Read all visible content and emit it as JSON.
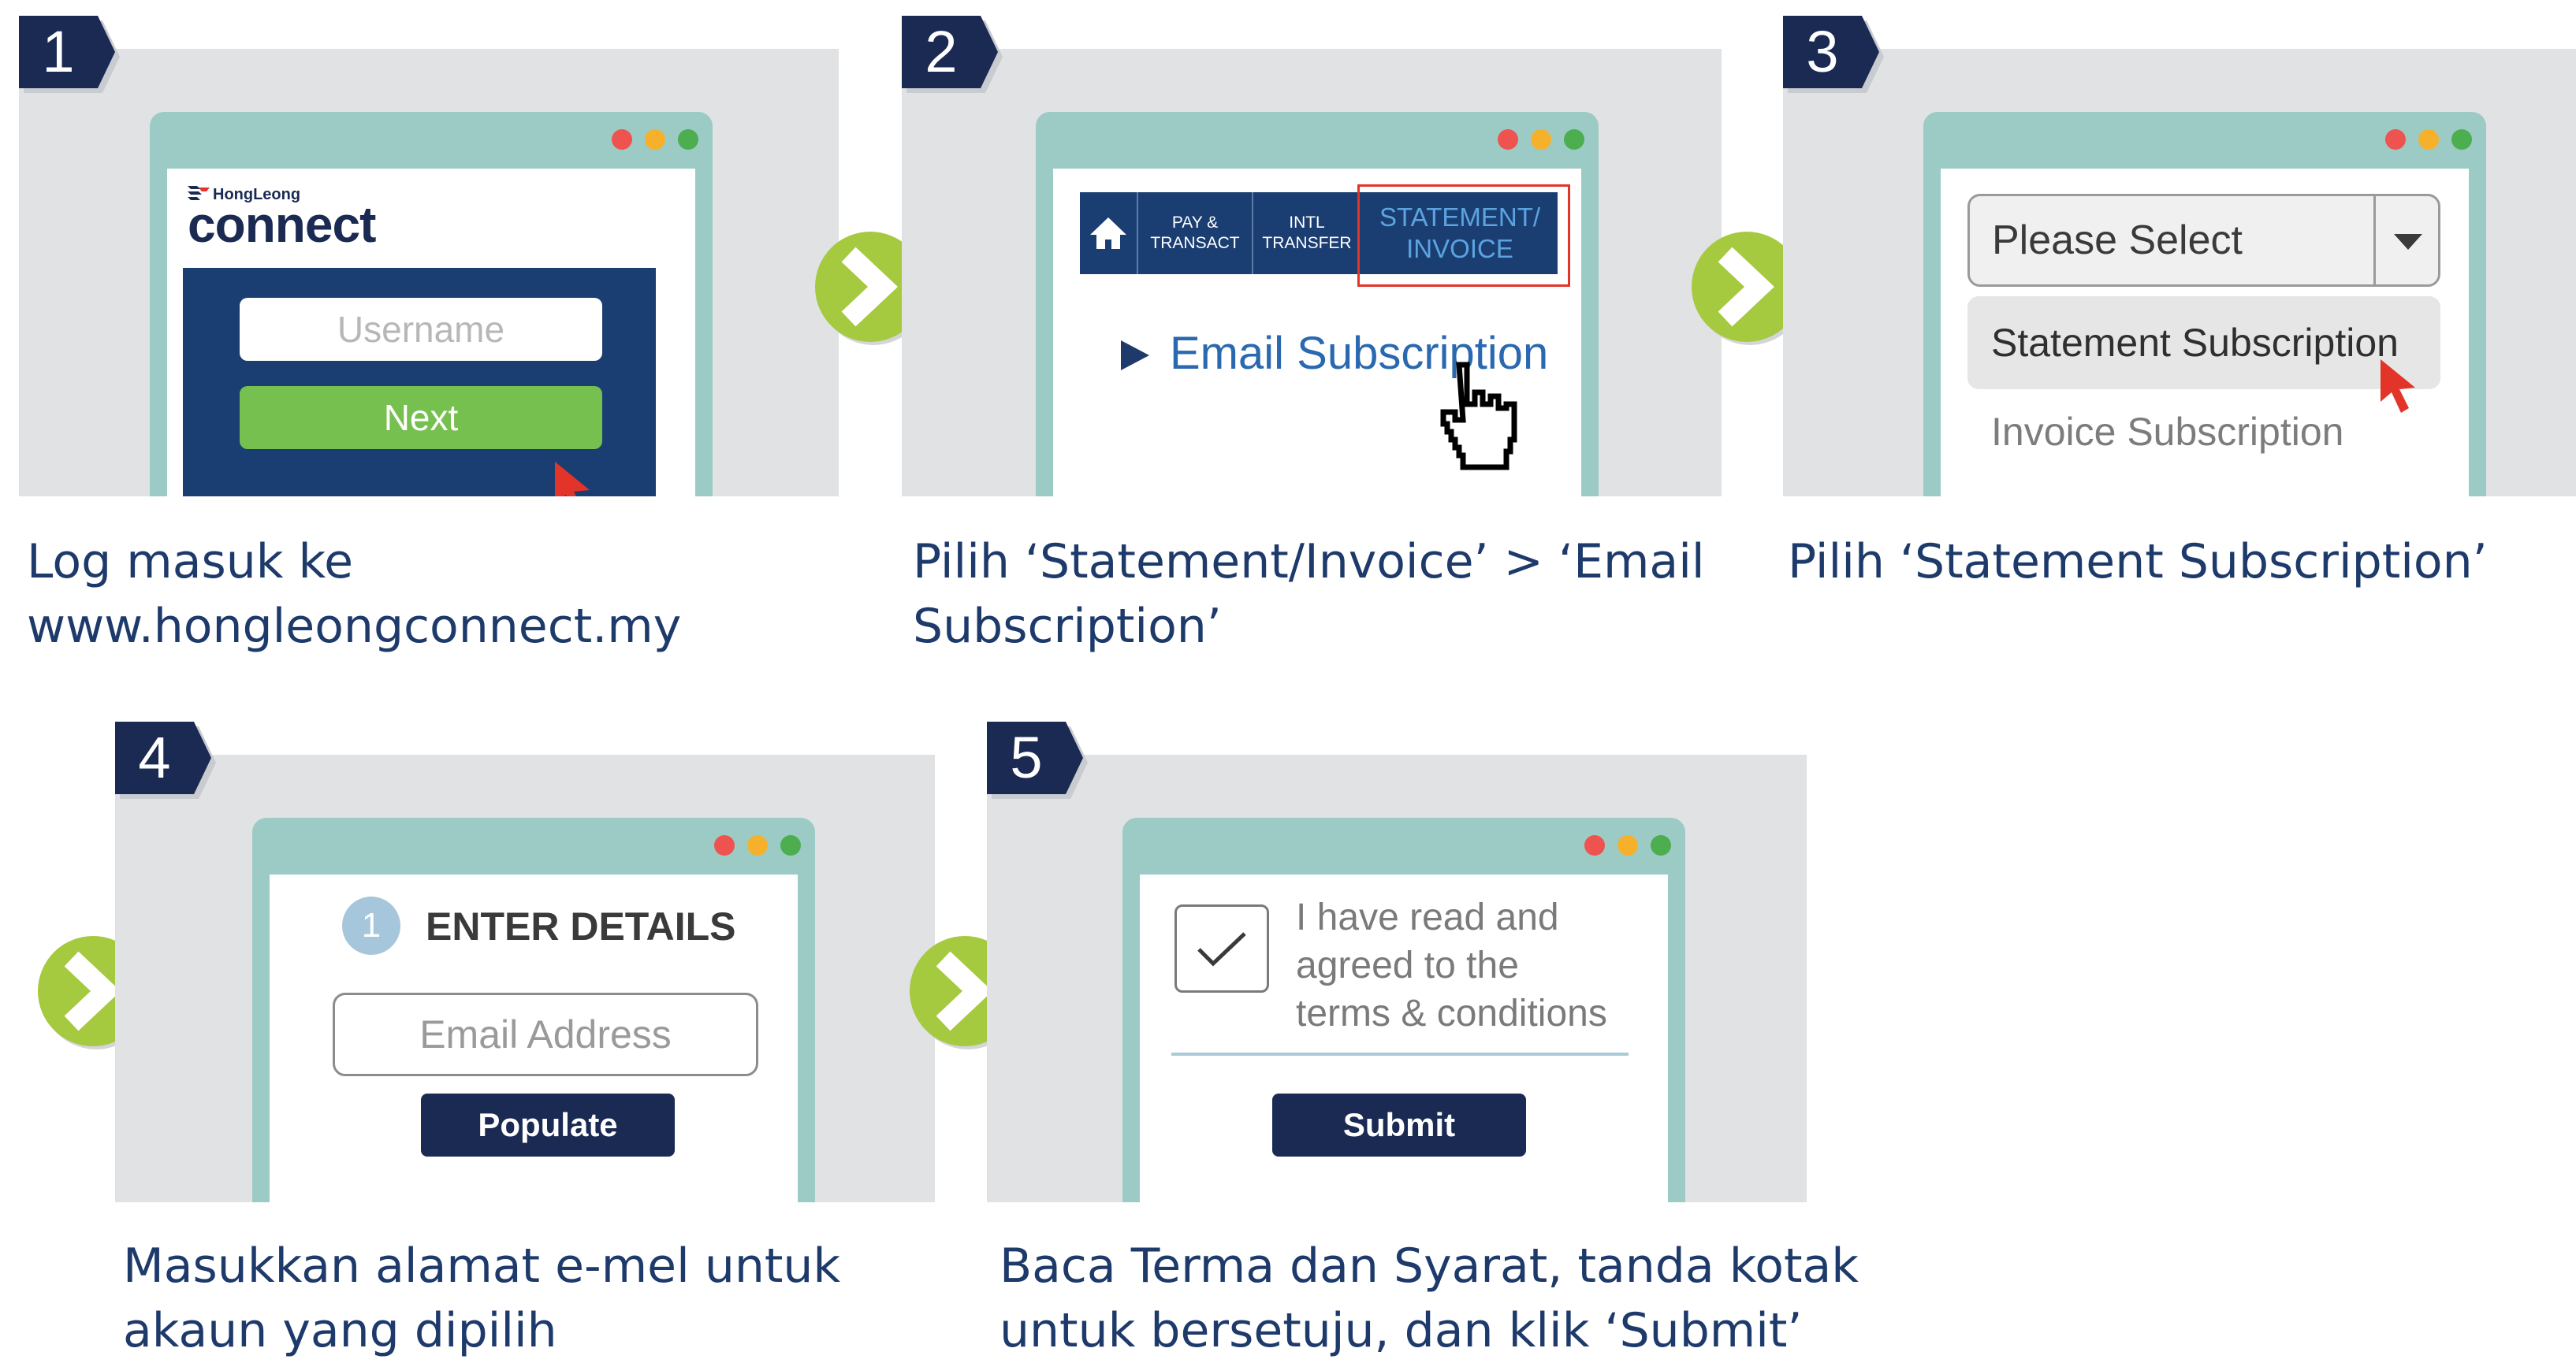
{
  "colors": {
    "navy": "#1a2a52",
    "panel_grey": "#e1e2e4",
    "window_teal": "#9ccbc6",
    "lime_green": "#a5c93f",
    "next_green": "#76c050",
    "caption_blue": "#1d3a6b",
    "link_blue": "#2a69b0",
    "cursor_red": "#e23428"
  },
  "steps": [
    {
      "number": "1",
      "caption_line1": "Log masuk ke",
      "caption_line2": "www.hongleongconnect.my",
      "logo_top": "HongLeong",
      "logo_main": "connect",
      "username_placeholder": "Username",
      "next_label": "Next"
    },
    {
      "number": "2",
      "caption_line1": "Pilih ‘Statement/Invoice’ > ‘Email",
      "caption_line2": "Subscription’",
      "nav": {
        "pay_line1": "PAY &",
        "pay_line2": "TRANSACT",
        "intl_line1": "INTL",
        "intl_line2": "TRANSFER",
        "statement_line1": "STATEMENT/",
        "statement_line2": "INVOICE"
      },
      "menu_item": "Email Subscription"
    },
    {
      "number": "3",
      "caption_line1": "Pilih ‘Statement Subscription’",
      "select_value": "Please Select",
      "option_1": "Statement Subscription",
      "option_2": "Invoice Subscription"
    },
    {
      "number": "4",
      "caption_line1": "Masukkan alamat e-mel untuk",
      "caption_line2": "akaun yang dipilih",
      "step_circle": "1",
      "heading": "ENTER DETAILS",
      "email_placeholder": "Email Address",
      "populate_label": "Populate"
    },
    {
      "number": "5",
      "caption_line1": "Baca Terma dan Syarat, tanda kotak",
      "caption_line2": "untuk bersetuju, dan klik ‘Submit’",
      "terms_line1": "I have read and",
      "terms_line2": "agreed to the",
      "terms_line3": "terms & conditions",
      "submit_label": "Submit"
    }
  ]
}
